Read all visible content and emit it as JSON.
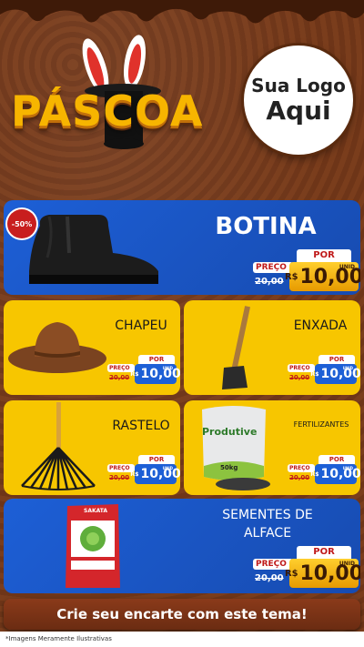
{
  "header": {
    "title": "PÁSCOA",
    "logo_line1": "Sua Logo",
    "logo_line2": "Aqui"
  },
  "products": [
    {
      "name": "BOTINA",
      "badge": "-50%",
      "por": "POR",
      "preco": "PREÇO",
      "old_price": "20,00",
      "currency": "R$",
      "price": "10,00",
      "unit": "UNID"
    },
    {
      "name": "CHAPEU",
      "por": "POR",
      "preco": "PREÇO",
      "old_price": "20,00",
      "currency": "R$",
      "price": "10,00",
      "unit": "UNID"
    },
    {
      "name": "ENXADA",
      "por": "POR",
      "preco": "PREÇO",
      "old_price": "20,00",
      "currency": "R$",
      "price": "10,00",
      "unit": "UNID"
    },
    {
      "name": "RASTELO",
      "por": "POR",
      "preco": "PREÇO",
      "old_price": "20,00",
      "currency": "R$",
      "price": "10,00",
      "unit": "UNID"
    },
    {
      "name": "FERTILIZANTES",
      "por": "POR",
      "preco": "PREÇO",
      "old_price": "20,00",
      "currency": "R$",
      "price": "10,00",
      "unit": "UNID",
      "bag_brand": "Produtive",
      "bag_weight": "50kg"
    },
    {
      "name_line1": "SEMENTES DE",
      "name_line2": "ALFACE",
      "por": "POR",
      "preco": "PREÇO",
      "old_price": "20,00",
      "currency": "R$",
      "price": "10,00",
      "unit": "UNID",
      "pack_brand": "SAKATA"
    }
  ],
  "footer": {
    "cta": "Crie seu encarte com este tema!",
    "note": "*Imagens Meramente Ilustrativas"
  },
  "colors": {
    "chocolate": "#6b3418",
    "blue": "#1d5fd6",
    "yellow": "#f7c600",
    "gold": "#ffcf2e",
    "red": "#c01a1a"
  }
}
